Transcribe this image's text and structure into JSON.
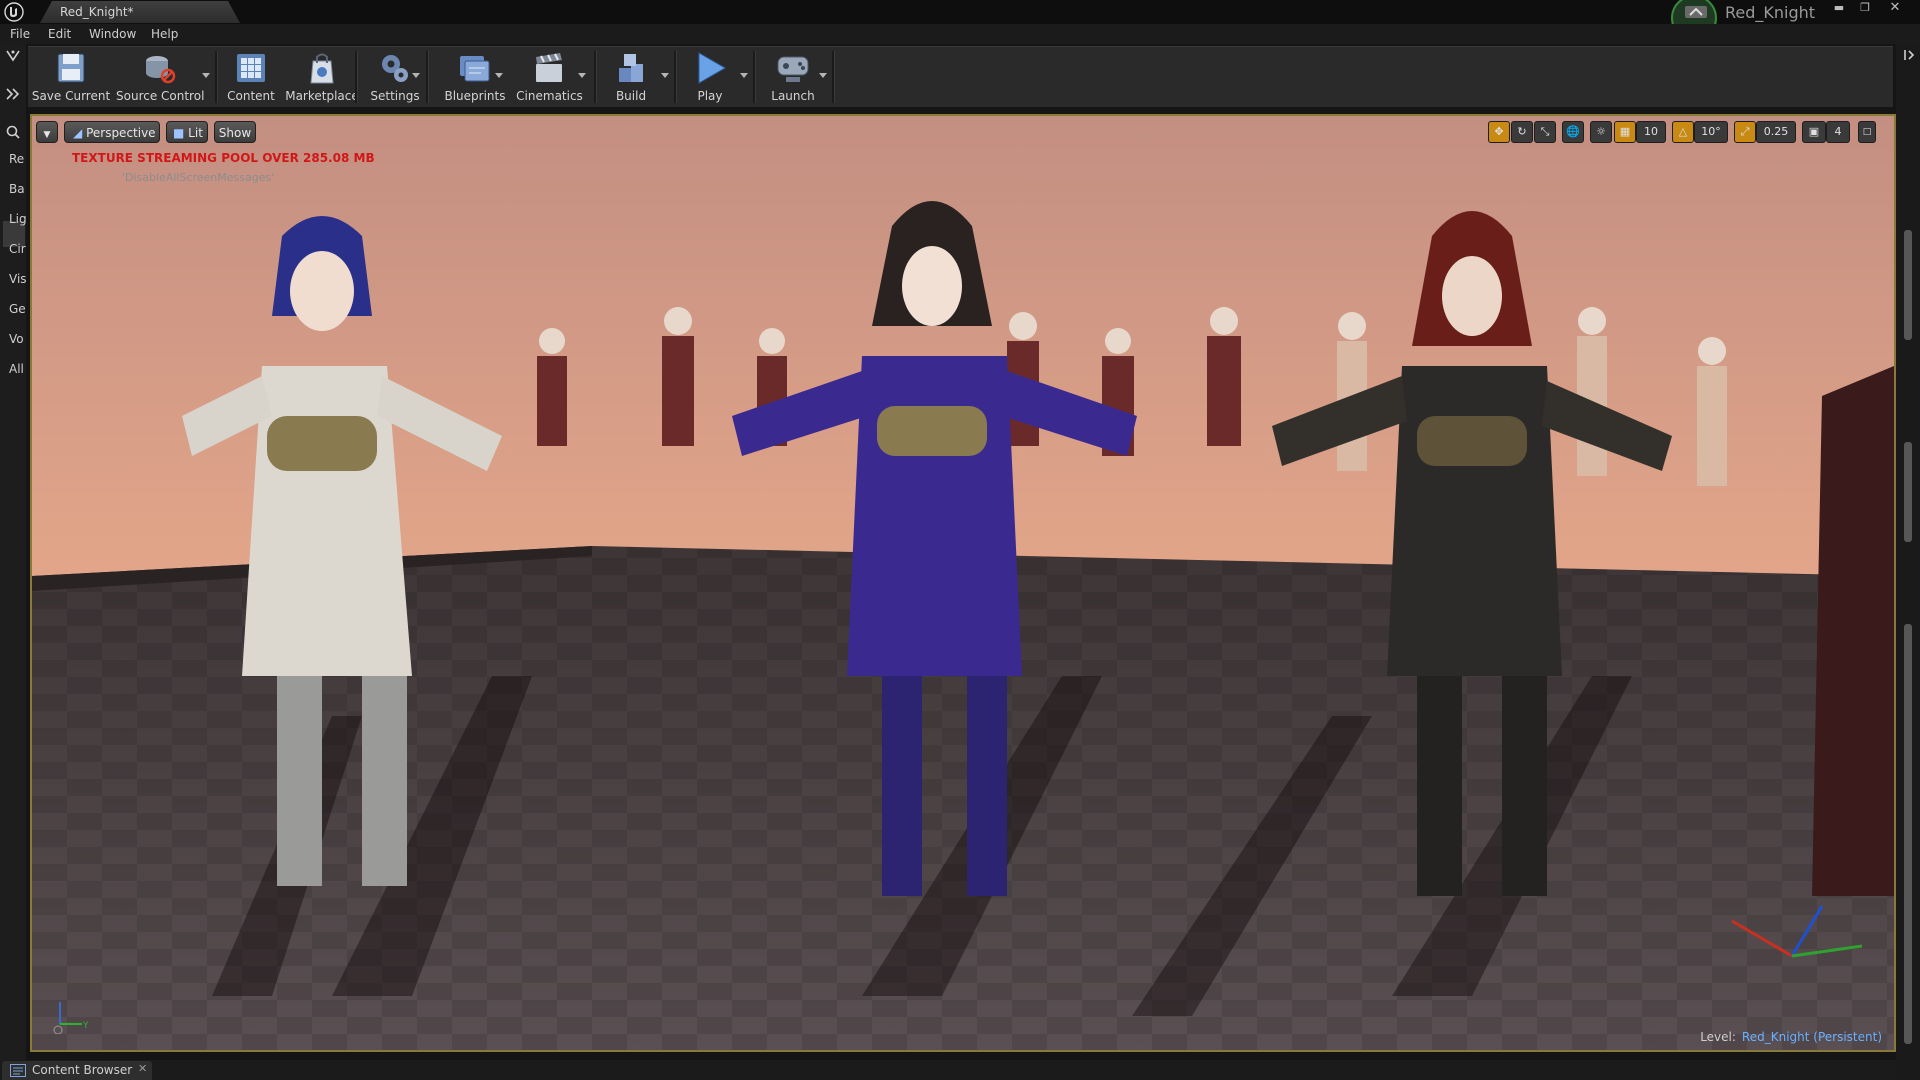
{
  "window": {
    "tab_title": "Red_Knight*",
    "project_name": "Red_Knight",
    "controls": [
      "minimize",
      "restore",
      "close"
    ]
  },
  "menu": {
    "items": [
      "File",
      "Edit",
      "Window",
      "Help"
    ]
  },
  "toolbar": {
    "buttons": [
      {
        "label": "Save Current",
        "icon": "floppy-disk-icon"
      },
      {
        "label": "Source Control",
        "icon": "source-control-icon"
      },
      {
        "label": "Content",
        "icon": "content-grid-icon"
      },
      {
        "label": "Marketplace",
        "icon": "marketplace-bag-icon"
      },
      {
        "label": "Settings",
        "icon": "gears-icon"
      },
      {
        "label": "Blueprints",
        "icon": "blueprint-icon"
      },
      {
        "label": "Cinematics",
        "icon": "clapperboard-icon"
      },
      {
        "label": "Build",
        "icon": "build-blocks-icon"
      },
      {
        "label": "Play",
        "icon": "play-triangle-icon"
      },
      {
        "label": "Launch",
        "icon": "launch-console-icon"
      }
    ]
  },
  "left_modes": {
    "tabs": [
      "Re",
      "Ba",
      "Lig",
      "Cir",
      "Vis",
      "Ge",
      "Vo",
      "All"
    ],
    "active": "Ba"
  },
  "viewport": {
    "view_mode": "Perspective",
    "lighting_mode": "Lit",
    "show_label": "Show",
    "grid_snap": "10",
    "rotation_snap": "10°",
    "scale_snap": "0.25",
    "camera_speed": "4",
    "warning": "TEXTURE STREAMING POOL OVER 285.08 MB",
    "disable_message": "'DisableAllScreenMessages'",
    "level_label": "Level:",
    "level_name": "Red_Knight (Persistent)",
    "colors": {
      "sky_top": "#c98f7e",
      "sky_bottom": "#f2b189",
      "floor": "#4d4346",
      "warning": "#d01818",
      "level_link": "#6ab0ff",
      "viewport_border": "#8a7a3a"
    }
  },
  "bottom": {
    "content_browser": "Content Browser"
  }
}
